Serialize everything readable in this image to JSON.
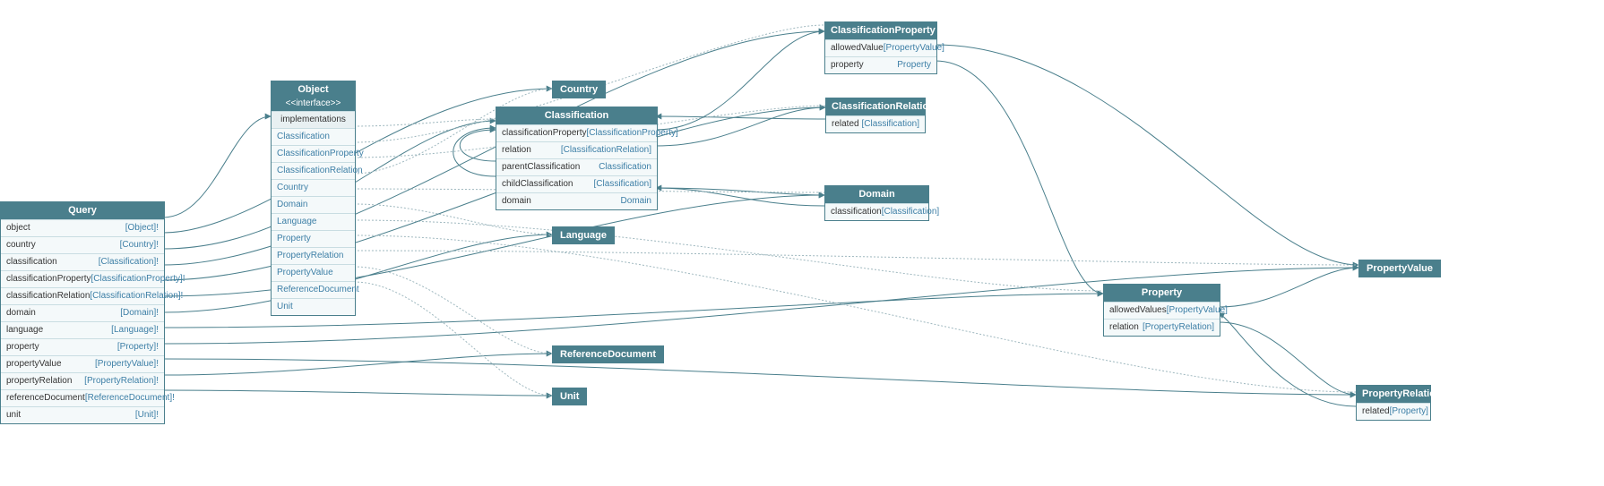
{
  "nodes": {
    "query": {
      "title": "Query",
      "rows": [
        {
          "key": "object",
          "value": "[Object]!"
        },
        {
          "key": "country",
          "value": "[Country]!"
        },
        {
          "key": "classification",
          "value": "[Classification]!"
        },
        {
          "key": "classificationProperty",
          "value": "[ClassificationProperty]!"
        },
        {
          "key": "classificationRelation",
          "value": "[ClassificationRelation]!"
        },
        {
          "key": "domain",
          "value": "[Domain]!"
        },
        {
          "key": "language",
          "value": "[Language]!"
        },
        {
          "key": "property",
          "value": "[Property]!"
        },
        {
          "key": "propertyValue",
          "value": "[PropertyValue]!"
        },
        {
          "key": "propertyRelation",
          "value": "[PropertyRelation]!"
        },
        {
          "key": "referenceDocument",
          "value": "[ReferenceDocument]!"
        },
        {
          "key": "unit",
          "value": "[Unit]!"
        }
      ]
    },
    "object": {
      "title": "Object",
      "subtitle": "<<interface>>",
      "sectionLabel": "implementations",
      "impl": [
        "Classification",
        "ClassificationProperty",
        "ClassificationRelation",
        "Country",
        "Domain",
        "Language",
        "Property",
        "PropertyRelation",
        "PropertyValue",
        "ReferenceDocument",
        "Unit"
      ]
    },
    "classification": {
      "title": "Classification",
      "rows": [
        {
          "key": "classificationProperty",
          "value": "[ClassificationProperty]"
        },
        {
          "key": "relation",
          "value": "[ClassificationRelation]"
        },
        {
          "key": "parentClassification",
          "value": "Classification"
        },
        {
          "key": "childClassification",
          "value": "[Classification]"
        },
        {
          "key": "domain",
          "value": "Domain"
        }
      ]
    },
    "classificationProperty": {
      "title": "ClassificationProperty",
      "rows": [
        {
          "key": "allowedValue",
          "value": "[PropertyValue]"
        },
        {
          "key": "property",
          "value": "Property"
        }
      ]
    },
    "classificationRelation": {
      "title": "ClassificationRelation",
      "rows": [
        {
          "key": "related",
          "value": "[Classification]"
        }
      ]
    },
    "domain": {
      "title": "Domain",
      "rows": [
        {
          "key": "classification",
          "value": "[Classification]"
        }
      ]
    },
    "property": {
      "title": "Property",
      "rows": [
        {
          "key": "allowedValues",
          "value": "[PropertyValue]"
        },
        {
          "key": "relation",
          "value": "[PropertyRelation]"
        }
      ]
    },
    "propertyRelation": {
      "title": "PropertyRelation",
      "rows": [
        {
          "key": "related",
          "value": "[Property]"
        }
      ]
    },
    "country": {
      "title": "Country"
    },
    "language": {
      "title": "Language"
    },
    "referenceDocument": {
      "title": "ReferenceDocument"
    },
    "unit": {
      "title": "Unit"
    },
    "propertyValue": {
      "title": "PropertyValue"
    }
  }
}
